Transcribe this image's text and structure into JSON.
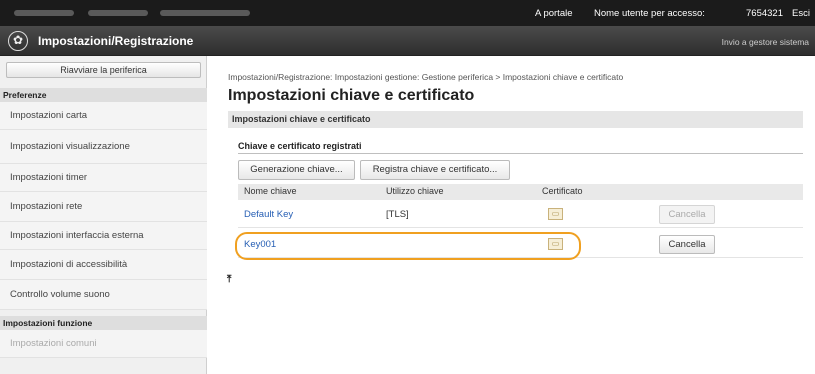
{
  "topbar": {
    "portal_link": "A portale",
    "user_label": "Nome utente per accesso:",
    "user_value": "7654321",
    "logout": "Esci"
  },
  "titlebar": {
    "title": "Impostazioni/Registrazione",
    "send_link": "Invio a gestore sistema"
  },
  "sidebar": {
    "restart_button": "Riavviare la periferica",
    "section_preferences": "Preferenze",
    "items": [
      {
        "label": "Impostazioni carta"
      },
      {
        "label": "Impostazioni visualizzazione"
      },
      {
        "label": "Impostazioni timer"
      },
      {
        "label": "Impostazioni rete"
      },
      {
        "label": "Impostazioni interfaccia esterna"
      },
      {
        "label": "Impostazioni di accessibilità"
      },
      {
        "label": "Controllo volume suono"
      }
    ],
    "section_functions": "Impostazioni funzione",
    "function_items": [
      {
        "label": "Impostazioni comuni"
      }
    ]
  },
  "main": {
    "breadcrumb": "Impostazioni/Registrazione: Impostazioni gestione: Gestione periferica > Impostazioni chiave e certificato",
    "title": "Impostazioni chiave e certificato",
    "section": "Impostazioni chiave e certificato",
    "sub_title": "Chiave e certificato registrati",
    "buttons": {
      "generate": "Generazione chiave...",
      "register": "Registra chiave e certificato..."
    },
    "columns": [
      "Nome chiave",
      "Utilizzo chiave",
      "Certificato"
    ],
    "rows": [
      {
        "name": "Default Key",
        "usage": "[TLS]",
        "delete": "Cancella"
      },
      {
        "name": "Key001",
        "usage": "",
        "delete": "Cancella"
      }
    ]
  },
  "colors": {
    "highlight": "#f0a020",
    "link": "#2860b5"
  }
}
